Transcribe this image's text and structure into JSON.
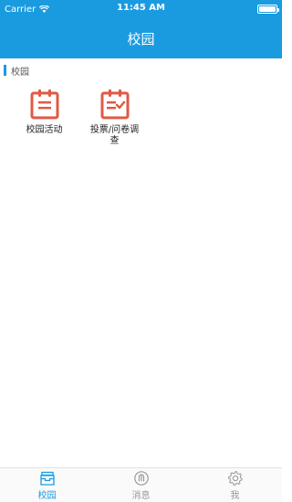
{
  "status": {
    "carrier": "Carrier",
    "time": "11:45 AM",
    "battery_level": 1.0
  },
  "header": {
    "title": "校园"
  },
  "section": {
    "title": "校园"
  },
  "grid": [
    {
      "label": "校园活动",
      "icon": "clipboard-list-icon"
    },
    {
      "label": "投票/问卷调查",
      "icon": "clipboard-check-icon"
    }
  ],
  "tabs": [
    {
      "label": "校园",
      "icon": "inbox-tray-icon",
      "active": true
    },
    {
      "label": "消息",
      "icon": "message-circle-icon",
      "active": false
    },
    {
      "label": "我",
      "icon": "gear-icon",
      "active": false
    }
  ],
  "colors": {
    "accent": "#1a9be0",
    "icon_red": "#e05a45"
  }
}
